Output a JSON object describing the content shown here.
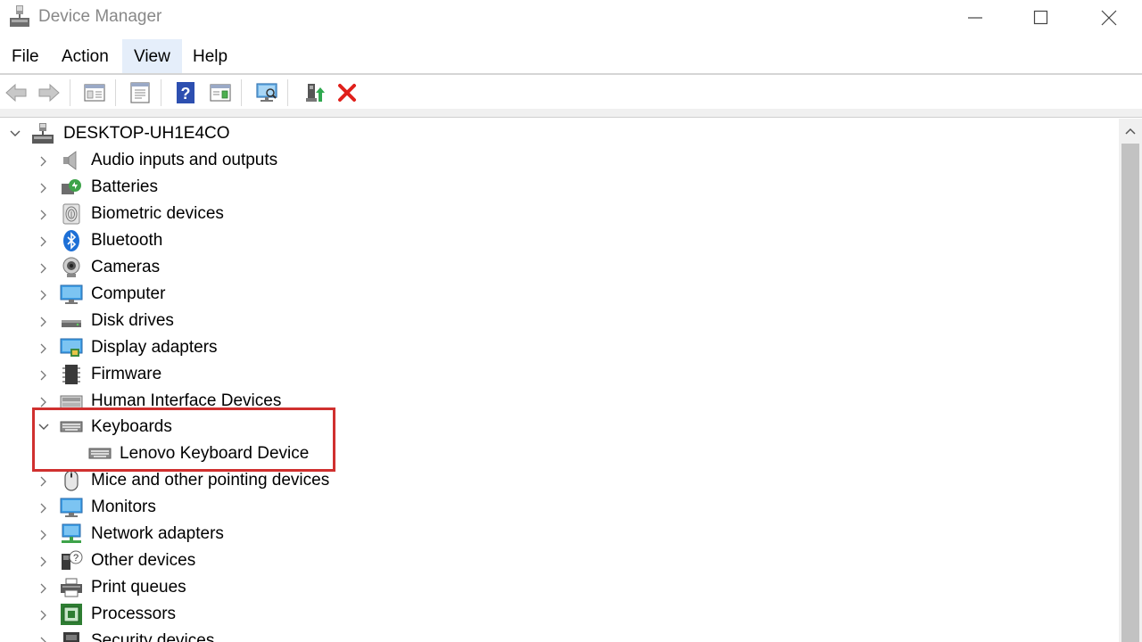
{
  "window": {
    "title": "Device Manager"
  },
  "menu": {
    "items": [
      {
        "label": "File"
      },
      {
        "label": "Action"
      },
      {
        "label": "View"
      },
      {
        "label": "Help"
      }
    ],
    "active": "View"
  },
  "toolbar": {
    "buttons": [
      {
        "name": "back-arrow-icon",
        "enabled": false
      },
      {
        "name": "forward-arrow-icon",
        "enabled": false
      },
      {
        "name": "show-hide-console-tree-icon",
        "enabled": true
      },
      {
        "name": "properties-icon",
        "enabled": true
      },
      {
        "name": "help-icon",
        "enabled": true
      },
      {
        "name": "action-pane-icon",
        "enabled": true
      },
      {
        "name": "scan-hardware-changes-icon",
        "enabled": true
      },
      {
        "name": "update-driver-icon",
        "enabled": true
      },
      {
        "name": "uninstall-device-icon",
        "enabled": true
      }
    ]
  },
  "tree": {
    "root": "DESKTOP-UH1E4CO",
    "categories": [
      {
        "label": "Audio inputs and outputs",
        "icon": "speaker-icon",
        "expanded": false
      },
      {
        "label": "Batteries",
        "icon": "battery-icon",
        "expanded": false
      },
      {
        "label": "Biometric devices",
        "icon": "fingerprint-icon",
        "expanded": false
      },
      {
        "label": "Bluetooth",
        "icon": "bluetooth-icon",
        "expanded": false
      },
      {
        "label": "Cameras",
        "icon": "camera-icon",
        "expanded": false
      },
      {
        "label": "Computer",
        "icon": "monitor-icon",
        "expanded": false
      },
      {
        "label": "Disk drives",
        "icon": "disk-drive-icon",
        "expanded": false
      },
      {
        "label": "Display adapters",
        "icon": "display-adapter-icon",
        "expanded": false
      },
      {
        "label": "Firmware",
        "icon": "firmware-chip-icon",
        "expanded": false
      },
      {
        "label": "Human Interface Devices",
        "icon": "hid-icon",
        "expanded": false
      },
      {
        "label": "Keyboards",
        "icon": "keyboard-icon",
        "expanded": true,
        "children": [
          "Lenovo Keyboard Device"
        ]
      },
      {
        "label": "Mice and other pointing devices",
        "icon": "mouse-icon",
        "expanded": false
      },
      {
        "label": "Monitors",
        "icon": "monitor-icon",
        "expanded": false
      },
      {
        "label": "Network adapters",
        "icon": "network-adapter-icon",
        "expanded": false
      },
      {
        "label": "Other devices",
        "icon": "unknown-device-icon",
        "expanded": false
      },
      {
        "label": "Print queues",
        "icon": "printer-icon",
        "expanded": false
      },
      {
        "label": "Processors",
        "icon": "processor-icon",
        "expanded": false
      },
      {
        "label": "Security devices",
        "icon": "security-device-icon",
        "expanded": false
      }
    ]
  },
  "colors": {
    "highlight": "#d0302f",
    "menu_active": "#e5eefa",
    "title_text": "#888888",
    "uninstall_red": "#e0201b",
    "help_blue": "#2d4fb0"
  }
}
